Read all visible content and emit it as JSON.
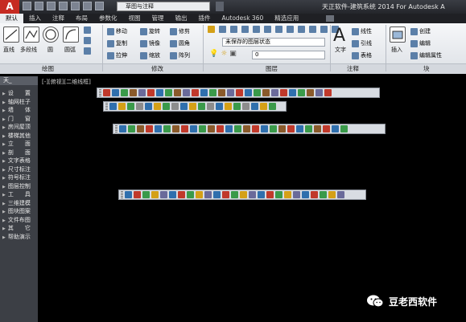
{
  "app": {
    "logo": "A",
    "title": "天正软件-建筑系统 2014  For Autodesk A",
    "workspace": "草图与注释"
  },
  "tabs": [
    "默认",
    "插入",
    "注释",
    "布局",
    "参数化",
    "视图",
    "管理",
    "输出",
    "插件",
    "Autodesk 360",
    "精选应用"
  ],
  "ribbon": {
    "draw": {
      "label": "绘图",
      "line": "直线",
      "polyline": "多段线",
      "circle": "圆",
      "arc": "圆弧"
    },
    "modify": {
      "label": "修改",
      "items": [
        "移动",
        "旋转",
        "修剪",
        "复制",
        "镜像",
        "圆角",
        "拉伸",
        "缩放",
        "阵列"
      ]
    },
    "layers": {
      "label": "图层",
      "layer_state": "未保存的图层状态",
      "current_layer": "0"
    },
    "annotation": {
      "label": "注释",
      "text": "文字",
      "items": [
        "线性",
        "引线",
        "表格"
      ]
    },
    "block": {
      "label": "块",
      "insert": "插入",
      "items": [
        "创建",
        "编辑",
        "编辑属性"
      ]
    }
  },
  "palette": {
    "title": "天_",
    "items": [
      "设　　置",
      "轴网柱子",
      "墙　　体",
      "门　　窗",
      "房间屋顶",
      "楼梯其他",
      "立　　面",
      "剖　　面",
      "文字表格",
      "尺寸标注",
      "符号标注",
      "图层控制",
      "工　　具",
      "三维建模",
      "图块图案",
      "文件布图",
      "其　　它",
      "帮助演示"
    ]
  },
  "canvas": {
    "viewport_label": "[-][俯视][二维线框]"
  },
  "toolbars": [
    {
      "name": "toolbar-1",
      "count": 26,
      "colors": [
        "#c0392b",
        "#2f6fad",
        "#3a9a4a",
        "#8a5a2b",
        "#6a6a9a"
      ]
    },
    {
      "name": "toolbar-2",
      "count": 19,
      "colors": [
        "#2f6fad",
        "#d4a017",
        "#3a9a4a",
        "#8c8c8c"
      ]
    },
    {
      "name": "toolbar-3",
      "count": 26,
      "colors": [
        "#2f6fad",
        "#3a9a4a",
        "#8a5a2b",
        "#c0392b"
      ]
    },
    {
      "name": "toolbar-4",
      "count": 25,
      "colors": [
        "#2f6fad",
        "#c0392b",
        "#3a9a4a",
        "#d4a017",
        "#6a6a9a"
      ]
    }
  ],
  "watermark": {
    "text": "豆老西软件",
    "icon": "wechat-icon"
  }
}
